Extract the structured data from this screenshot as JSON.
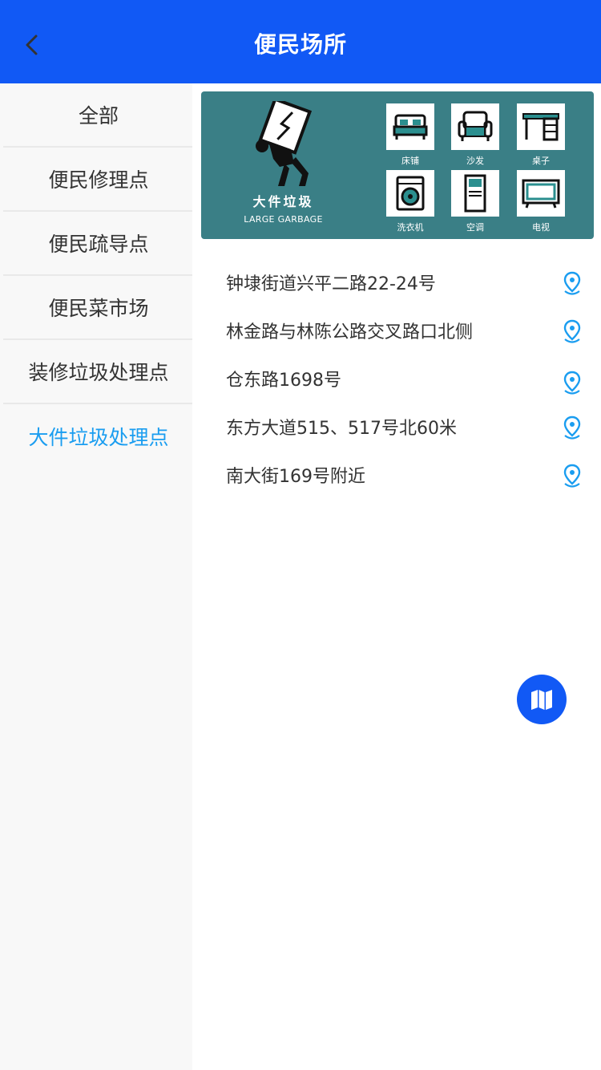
{
  "header": {
    "title": "便民场所"
  },
  "sidebar": {
    "items": [
      {
        "label": "全部"
      },
      {
        "label": "便民修理点"
      },
      {
        "label": "便民疏导点"
      },
      {
        "label": "便民菜市场"
      },
      {
        "label": "装修垃圾处理点"
      },
      {
        "label": "大件垃圾处理点"
      }
    ],
    "active_index": 5
  },
  "banner": {
    "title": "大件垃圾",
    "subtitle": "LARGE GARBAGE",
    "items": [
      {
        "label": "床铺",
        "icon": "bed-icon"
      },
      {
        "label": "沙发",
        "icon": "sofa-icon"
      },
      {
        "label": "桌子",
        "icon": "desk-icon"
      },
      {
        "label": "洗衣机",
        "icon": "washing-machine-icon"
      },
      {
        "label": "空调",
        "icon": "air-conditioner-icon"
      },
      {
        "label": "电视",
        "icon": "tv-icon"
      }
    ]
  },
  "addresses": [
    {
      "text": "钟埭街道兴平二路22-24号"
    },
    {
      "text": "林金路与林陈公路交叉路口北侧"
    },
    {
      "text": "仓东路1698号"
    },
    {
      "text": "东方大道515、517号北60米"
    },
    {
      "text": "南大街169号附近"
    }
  ],
  "colors": {
    "header_bg": "#1159f5",
    "active_text": "#1a9df0",
    "banner_bg": "#3a7f86",
    "pin": "#1a9df0"
  }
}
